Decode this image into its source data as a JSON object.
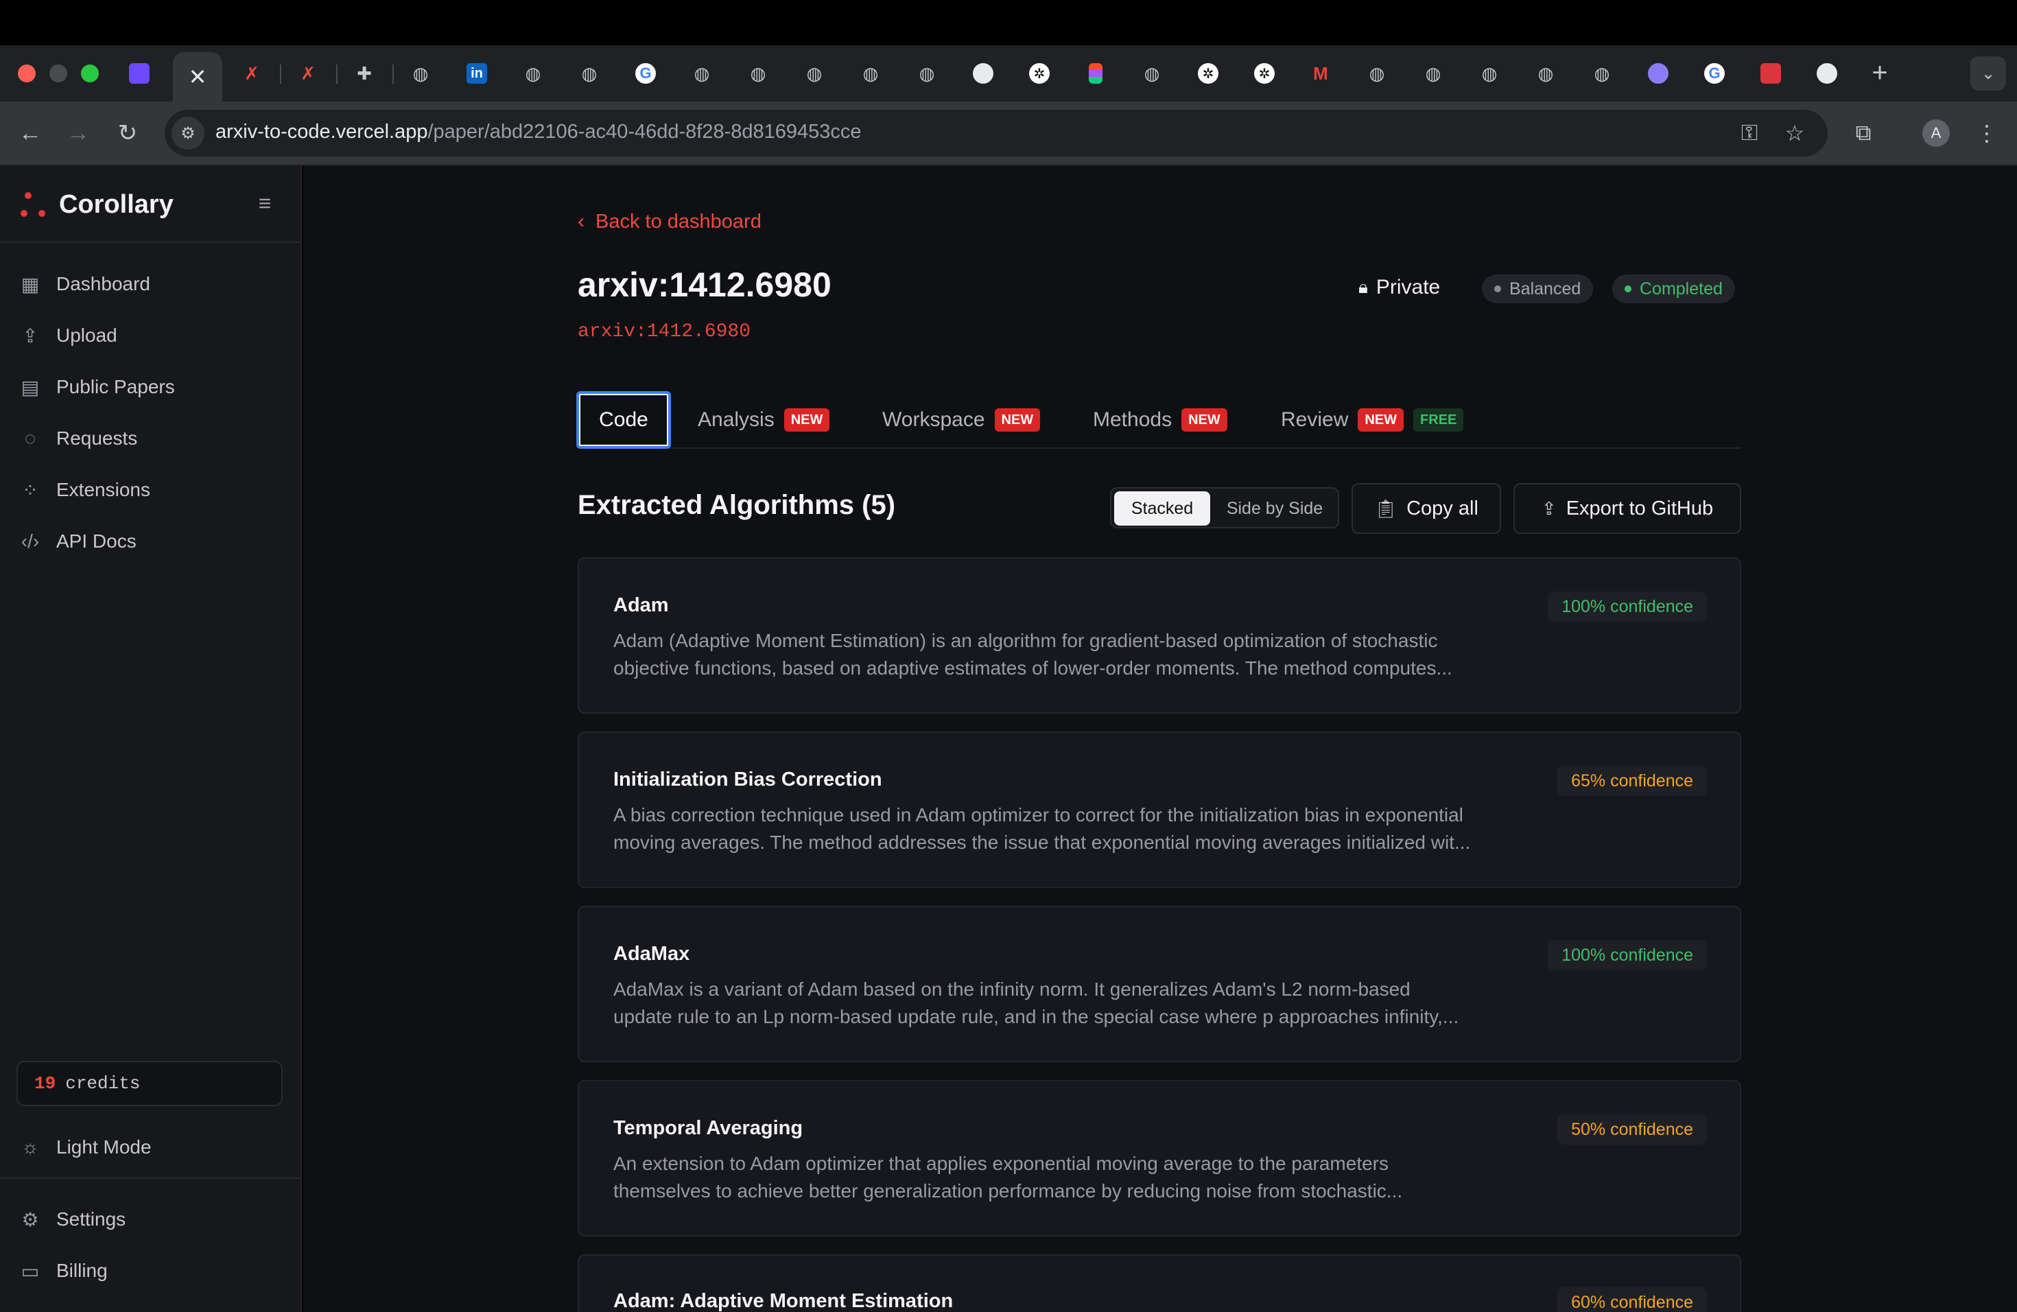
{
  "browser": {
    "url_host": "arxiv-to-code.vercel.app",
    "url_path": "/paper/abd22106-ac40-46dd-8f28-8d8169453cce",
    "profile_initial": "A",
    "active_tab_icon": "close-icon"
  },
  "sidebar": {
    "brand": "Corollary",
    "items": [
      {
        "label": "Dashboard",
        "icon": "grid-icon"
      },
      {
        "label": "Upload",
        "icon": "upload-icon"
      },
      {
        "label": "Public Papers",
        "icon": "document-icon"
      },
      {
        "label": "Requests",
        "icon": "lightbulb-icon"
      },
      {
        "label": "Extensions",
        "icon": "extensions-icon"
      },
      {
        "label": "API Docs",
        "icon": "code-icon"
      }
    ],
    "credits": {
      "count": "19",
      "label": "credits"
    },
    "footer": [
      {
        "label": "Light Mode",
        "icon": "sun-icon"
      },
      {
        "label": "Settings",
        "icon": "gear-icon"
      },
      {
        "label": "Billing",
        "icon": "card-icon"
      }
    ]
  },
  "page": {
    "back_label": "Back to dashboard",
    "title": "arxiv:1412.6980",
    "subtitle": "arxiv:1412.6980",
    "visibility": "Private",
    "mode_badge": "Balanced",
    "status_badge": "Completed",
    "colors": {
      "accent": "#f04a3e",
      "status_green": "#3fbf6a",
      "mode_gray": "#8a8a92"
    }
  },
  "tabs": [
    {
      "label": "Code",
      "active": true
    },
    {
      "label": "Analysis",
      "badge": "NEW"
    },
    {
      "label": "Workspace",
      "badge": "NEW"
    },
    {
      "label": "Methods",
      "badge": "NEW"
    },
    {
      "label": "Review",
      "badge": "NEW",
      "extra_badge": "FREE"
    }
  ],
  "algorithms": {
    "heading": "Extracted Algorithms (5)",
    "view_options": [
      "Stacked",
      "Side by Side"
    ],
    "selected_view": "Stacked",
    "copy_all_label": "Copy all",
    "export_label": "Export to GitHub",
    "items": [
      {
        "name": "Adam",
        "confidence": "100% confidence",
        "desc_line1": "Adam (Adaptive Moment Estimation) is an algorithm for gradient-based optimization of stochastic",
        "desc_line2": "objective functions, based on adaptive estimates of lower-order moments. The method computes..."
      },
      {
        "name": "Initialization Bias Correction",
        "confidence": "65% confidence",
        "desc_line1": "A bias correction technique used in Adam optimizer to correct for the initialization bias in exponential",
        "desc_line2": "moving averages. The method addresses the issue that exponential moving averages initialized wit..."
      },
      {
        "name": "AdaMax",
        "confidence": "100% confidence",
        "desc_line1": "AdaMax is a variant of Adam based on the infinity norm. It generalizes Adam's L2 norm-based",
        "desc_line2": "update rule to an Lp norm-based update rule, and in the special case where p approaches infinity,..."
      },
      {
        "name": "Temporal Averaging",
        "confidence": "50% confidence",
        "desc_line1": "An extension to Adam optimizer that applies exponential moving average to the parameters",
        "desc_line2": "themselves to achieve better generalization performance by reducing noise from stochastic..."
      },
      {
        "name": "Adam: Adaptive Moment Estimation",
        "confidence": "60% confidence",
        "desc_line1": "",
        "desc_line2": ""
      }
    ]
  }
}
